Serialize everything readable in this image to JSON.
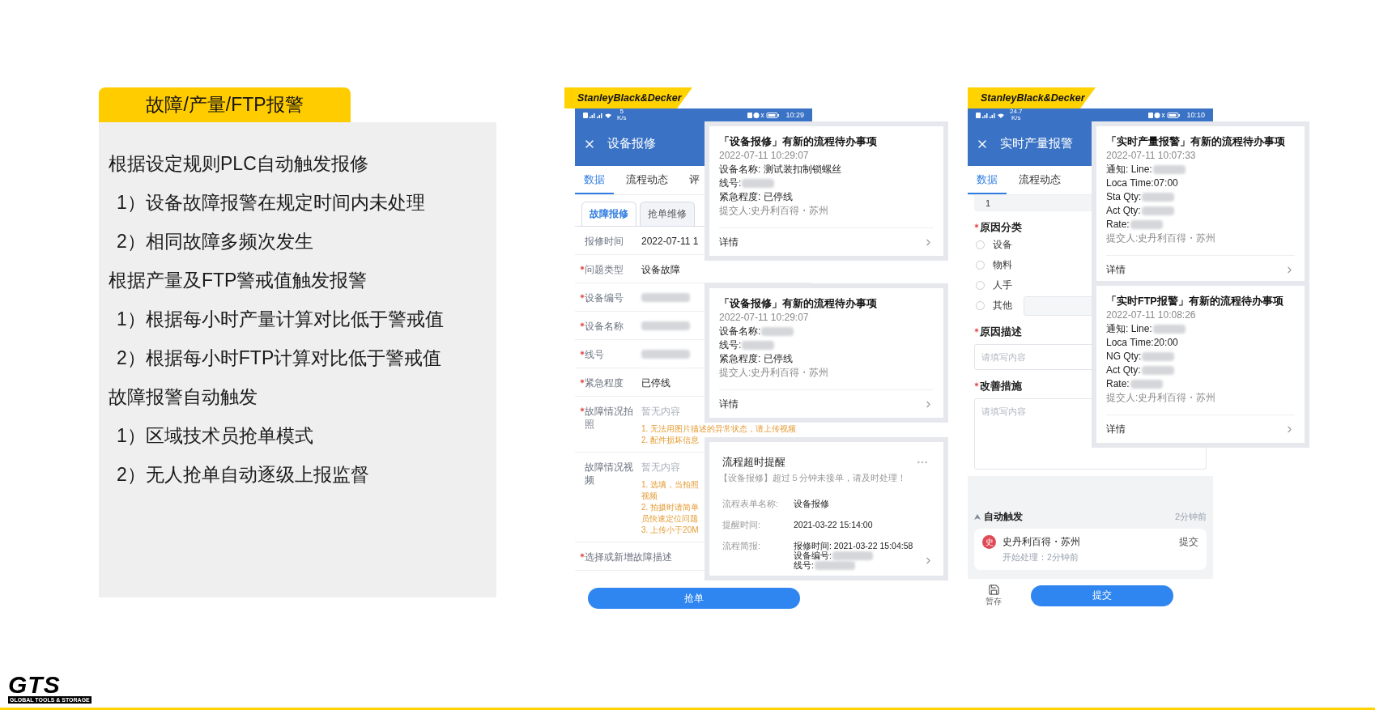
{
  "slide": {
    "heading": "故障/产量/FTP报警",
    "lines": [
      {
        "kind": "rule",
        "text": "根据设定规则PLC自动触发报修"
      },
      {
        "kind": "step",
        "text": "1）设备故障报警在规定时间内未处理"
      },
      {
        "kind": "step",
        "text": "2）相同故障多频次发生"
      },
      {
        "kind": "rule",
        "text": "根据产量及FTP警戒值触发报警"
      },
      {
        "kind": "step",
        "text": "1）根据每小时产量计算对比低于警戒值"
      },
      {
        "kind": "step",
        "text": "2）根据每小时FTP计算对比低于警戒值"
      },
      {
        "kind": "rule",
        "text": "故障报警自动触发"
      },
      {
        "kind": "step",
        "text": "1）区域技术员抢单模式"
      },
      {
        "kind": "step",
        "text": "2）无人抢单自动逐级上报监督"
      }
    ]
  },
  "repair_app": {
    "brand": "StanleyBlack&Decker",
    "status": {
      "speed": "5",
      "speed_unit": "K/s",
      "time": "10:29"
    },
    "title": "设备报修",
    "tabs": [
      {
        "label": "数据",
        "selected": true
      },
      {
        "label": "流程动态",
        "selected": false
      },
      {
        "label": "评",
        "selected": false
      }
    ],
    "subtabs": [
      {
        "label": "故障报修",
        "selected": true
      },
      {
        "label": "抢单维修",
        "selected": false
      }
    ],
    "fields": [
      {
        "label": "报修时间",
        "required": false,
        "value": "2022-07-11 1"
      },
      {
        "label": "问题类型",
        "required": true,
        "value": "设备故障"
      },
      {
        "label": "设备编号",
        "required": true,
        "blurred": true
      },
      {
        "label": "设备名称",
        "required": true,
        "blurred": true
      },
      {
        "label": "线号",
        "required": true,
        "blurred": true
      },
      {
        "label": "紧急程度",
        "required": true,
        "value": "已停线"
      },
      {
        "label": "故障情况拍照",
        "required": true,
        "empty_text": "暂无内容",
        "hints": [
          "1. 无法用图片描述的异常状态，请上传视频",
          "2. 配件损坏信息"
        ]
      },
      {
        "label": "故障情况视频",
        "required": false,
        "empty_text": "暂无内容",
        "hints": [
          "1. 选填，当拍照",
          "视频",
          "2. 拍摄时请简单",
          "员快速定位问题",
          "3. 上传小于20M"
        ]
      },
      {
        "label": "选择或新增故障描述",
        "required": true
      }
    ],
    "action": "抢单",
    "notifications": [
      {
        "kind": "todo",
        "title": "「设备报修」有新的流程待办事项",
        "time": "2022-07-11 10:29:07",
        "lines": [
          {
            "text": "设备名称: 测试装扣制锁螺丝"
          },
          {
            "text": "线号:",
            "blurred": true
          },
          {
            "text": "紧急程度: 已停线"
          }
        ],
        "submitter": "提交人:史丹利百得・苏州",
        "detail": "详情"
      },
      {
        "kind": "todo",
        "title": "「设备报修」有新的流程待办事项",
        "time": "2022-07-11 10:29:07",
        "lines": [
          {
            "text": "设备名称:",
            "blurred": true
          },
          {
            "text": "线号:",
            "blurred": true
          },
          {
            "text": "紧急程度: 已停线"
          }
        ],
        "submitter": "提交人:史丹利百得・苏州",
        "detail": "详情"
      },
      {
        "kind": "timeout",
        "title": "流程超时提醒",
        "message": "【设备报修】超过５分钟未接单，请及时处理！",
        "rows": [
          {
            "label": "流程表单名称:",
            "values": [
              {
                "text": "设备报修"
              }
            ]
          },
          {
            "label": "提醒时间:",
            "values": [
              {
                "text": "2021-03-22 15:14:00"
              }
            ]
          },
          {
            "label": "流程简报:",
            "values": [
              {
                "text": "报修时间: 2021-03-22 15:04:58"
              },
              {
                "text": "设备编号:",
                "blurred": true
              },
              {
                "text": "线号:",
                "blurred": true
              }
            ]
          }
        ]
      }
    ]
  },
  "production_app": {
    "brand": "StanleyBlack&Decker",
    "status": {
      "speed": "24.7",
      "speed_unit": "K/s",
      "time": "10:10"
    },
    "title": "实时产量报警",
    "tabs": [
      {
        "label": "数据",
        "selected": true
      },
      {
        "label": "流程动态",
        "selected": false
      }
    ],
    "top_value": "1",
    "reason": {
      "label": "原因分类",
      "required": true,
      "options": [
        {
          "kind": "plain",
          "label": "设备",
          "checked": false
        },
        {
          "kind": "plain",
          "label": "物料",
          "checked": false
        },
        {
          "kind": "plain",
          "label": "人手",
          "checked": false
        },
        {
          "kind": "other",
          "label": "其他",
          "checked": false
        }
      ]
    },
    "description": {
      "label": "原因描述",
      "required": true,
      "placeholder": "请填写内容"
    },
    "measures": {
      "label": "改善措施",
      "required": true,
      "placeholder": "请填写内容"
    },
    "activity": {
      "title": "自动触发",
      "ago": "2分钟前",
      "avatar": "史",
      "name": "史丹利百得・苏州",
      "action": "提交",
      "detail": "开始处理：2分钟前"
    },
    "save": "暂存",
    "submit": "提交",
    "notifications": [
      {
        "kind": "todo",
        "title": "「实时产量报警」有新的流程待办事项",
        "time": "2022-07-11 10:07:33",
        "lines": [
          {
            "text": "通知: Line:",
            "blurred": true
          },
          {
            "text": "Loca Time:07:00"
          },
          {
            "text": "Sta Qty:",
            "blurred": true
          },
          {
            "text": "Act Qty:",
            "blurred": true
          },
          {
            "text": "Rate:",
            "blurred": true
          }
        ],
        "submitter": "提交人:史丹利百得・苏州",
        "detail": "详情"
      },
      {
        "kind": "todo",
        "title": "「实时FTP报警」有新的流程待办事项",
        "time": "2022-07-11 10:08:26",
        "lines": [
          {
            "text": "通知: Line:",
            "blurred": true
          },
          {
            "text": "Loca Time:20:00"
          },
          {
            "text": "NG Qty:",
            "blurred": true
          },
          {
            "text": "Act Qty:",
            "blurred": true
          },
          {
            "text": "Rate:",
            "blurred": true
          }
        ],
        "submitter": "提交人:史丹利百得・苏州",
        "detail": "详情"
      }
    ]
  },
  "footer": {
    "logo": "GTS",
    "tagline": "GLOBAL TOOLS & STORAGE"
  }
}
